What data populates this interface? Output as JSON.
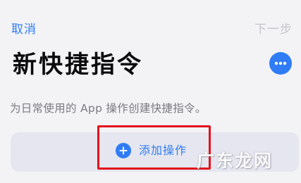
{
  "nav": {
    "cancel_label": "取消",
    "next_label": "下一步"
  },
  "page": {
    "title": "新快捷指令",
    "subtitle": "为日常使用的 App 操作创建快捷指令。"
  },
  "actions": {
    "add_label": "添加操作"
  },
  "watermark": {
    "text": "广东龙网"
  },
  "icons": {
    "more": "ellipsis-icon",
    "add": "plus-circle-icon"
  },
  "colors": {
    "accent": "#2f7cf6",
    "background": "#f3f3f6",
    "card": "#e5e6ef",
    "highlight": "#e2121c",
    "disabled": "#c5c5ca",
    "subtitle": "#7b7b80"
  }
}
